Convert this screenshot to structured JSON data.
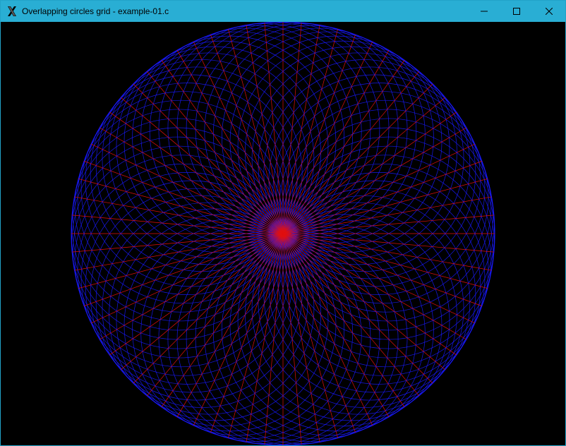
{
  "window": {
    "title": "Overlapping circles grid - example-01.c",
    "icon": "x-window-system-icon",
    "controls": [
      "minimize",
      "maximize",
      "close"
    ]
  },
  "colors": {
    "titlebar": "#29aed4",
    "canvas_background": "#000000",
    "circles": "#1a1aff",
    "spokes": "#e01010"
  },
  "drawing": {
    "description_count": {
      "outer_circle_count": 1
    }
  }
}
